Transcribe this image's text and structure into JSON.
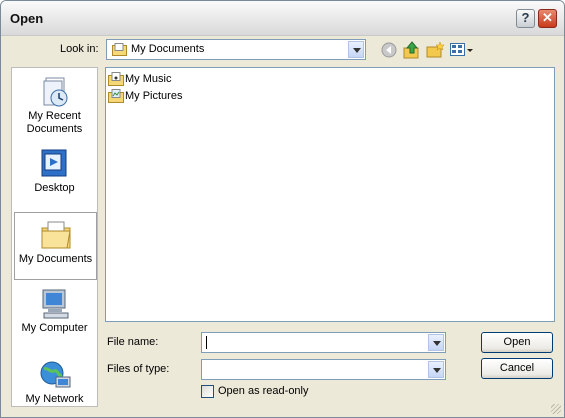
{
  "window": {
    "title": "Open",
    "help_symbol": "?",
    "close_symbol": "✕"
  },
  "toolbar": {
    "look_in_label": "Look in:",
    "look_in_value": "My Documents",
    "icons": [
      "back-icon",
      "up-folder-icon",
      "new-folder-icon",
      "view-menu-icon"
    ]
  },
  "places": [
    {
      "label": "My Recent Documents",
      "icon": "recent-documents-icon"
    },
    {
      "label": "Desktop",
      "icon": "desktop-icon"
    },
    {
      "label": "My Documents",
      "icon": "my-documents-icon",
      "selected": true
    },
    {
      "label": "My Computer",
      "icon": "my-computer-icon"
    },
    {
      "label": "My Network",
      "icon": "my-network-icon"
    }
  ],
  "files": [
    {
      "name": "My Music",
      "icon": "music-folder-icon"
    },
    {
      "name": "My Pictures",
      "icon": "pictures-folder-icon"
    }
  ],
  "form": {
    "file_name_label": "File name:",
    "file_name_value": "",
    "files_of_type_label": "Files of type:",
    "files_of_type_value": "",
    "read_only_label": "Open as read-only",
    "read_only_checked": false
  },
  "buttons": {
    "open": "Open",
    "cancel": "Cancel"
  },
  "colors": {
    "selection_border": "#a0a0a0",
    "field_border": "#7f9db9",
    "dialog_bg": "#ece9d8",
    "close_red": "#c83a1a"
  }
}
